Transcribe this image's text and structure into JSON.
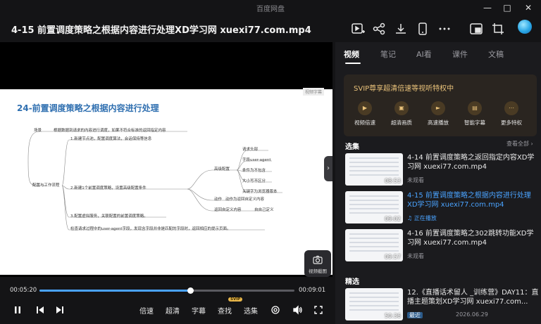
{
  "app": {
    "title": "百度网盘"
  },
  "header": {
    "file_title": "4-15 前置调度策略之根据内容进行处理XD学习网 xuexi77.com.mp4"
  },
  "slide": {
    "title": "24-前置调度策略之根据内容进行处理",
    "watermark": "视频字幕",
    "nodes": {
      "root": "配置与工作流程",
      "scene": "场景",
      "scene_desc": "根据数据到请求的内容进行调度，如果不符合标准的返回指定内容",
      "step1": "1.新建节点池，配置调度算法，会话保持等信息",
      "step2": "2.新建1个前置调度策略，设置高级配置条件",
      "advanced": "高级配置",
      "req_head": "请求头部",
      "ua": "字段user-agent",
      "cond": "条件为不包含",
      "case": "大小写不区分",
      "kw": "关键字为浏览器版本",
      "action": "动作",
      "action_desc": "动作为返回自定义内容",
      "ret": "返回自定义内容",
      "ret_desc": "自自己定义",
      "step3": "3.配置虚拟服务，关联配置的前置调度策略。",
      "check": "检查请求过程中的user-agent字段，发现含字段并非是匹配的字段时，返回相应的提示页面。"
    }
  },
  "player": {
    "current_time": "00:05:20",
    "total_time": "00:09:01",
    "progress": 0.59,
    "capture_label": "视频截图",
    "speed_label": "倍速",
    "quality_label": "超清",
    "subtitle_label": "字幕",
    "search_label": "查找",
    "search_badge": "SVIP",
    "episodes_label": "选集"
  },
  "panel": {
    "tabs": [
      {
        "label": "视频",
        "active": true
      },
      {
        "label": "笔记",
        "active": false
      },
      {
        "label": "AI看",
        "active": false
      },
      {
        "label": "课件",
        "active": false
      },
      {
        "label": "文稿",
        "active": false
      }
    ],
    "svip": {
      "headline": "SVIP尊享超清倍速等视听特权中",
      "perks": [
        "视频倍速",
        "超清画质",
        "高速播放",
        "智能字幕",
        "更多特权"
      ]
    },
    "episodes_heading": "选集",
    "see_all": "查看全部 ›",
    "episodes": [
      {
        "title": "4-14 前置调度策略之返回指定内容XD学习网 xuexi77.com.mp4",
        "duration": "08:53",
        "status": "未观看",
        "active": false
      },
      {
        "title": "4-15 前置调度策略之根据内容进行处理XD学习网 xuexi77.com.mp4",
        "duration": "09:02",
        "status": "正在播放",
        "active": true
      },
      {
        "title": "4-16 前置调度策略之302跳转功能XD学习网 xuexi77.com.mp4",
        "duration": "09:57",
        "status": "未观看",
        "active": false
      }
    ],
    "featured_heading": "精选",
    "featured": {
      "title": "12.《直播话术留人 _训练营》DAY11：直播主题策划XD学习网 xuexi77.com...",
      "duration": "50:36",
      "tag": "最近",
      "date": "2026.06.29"
    }
  },
  "colors": {
    "accent": "#4aa3ff",
    "gold": "#e9c27a",
    "bg": "#141416"
  }
}
